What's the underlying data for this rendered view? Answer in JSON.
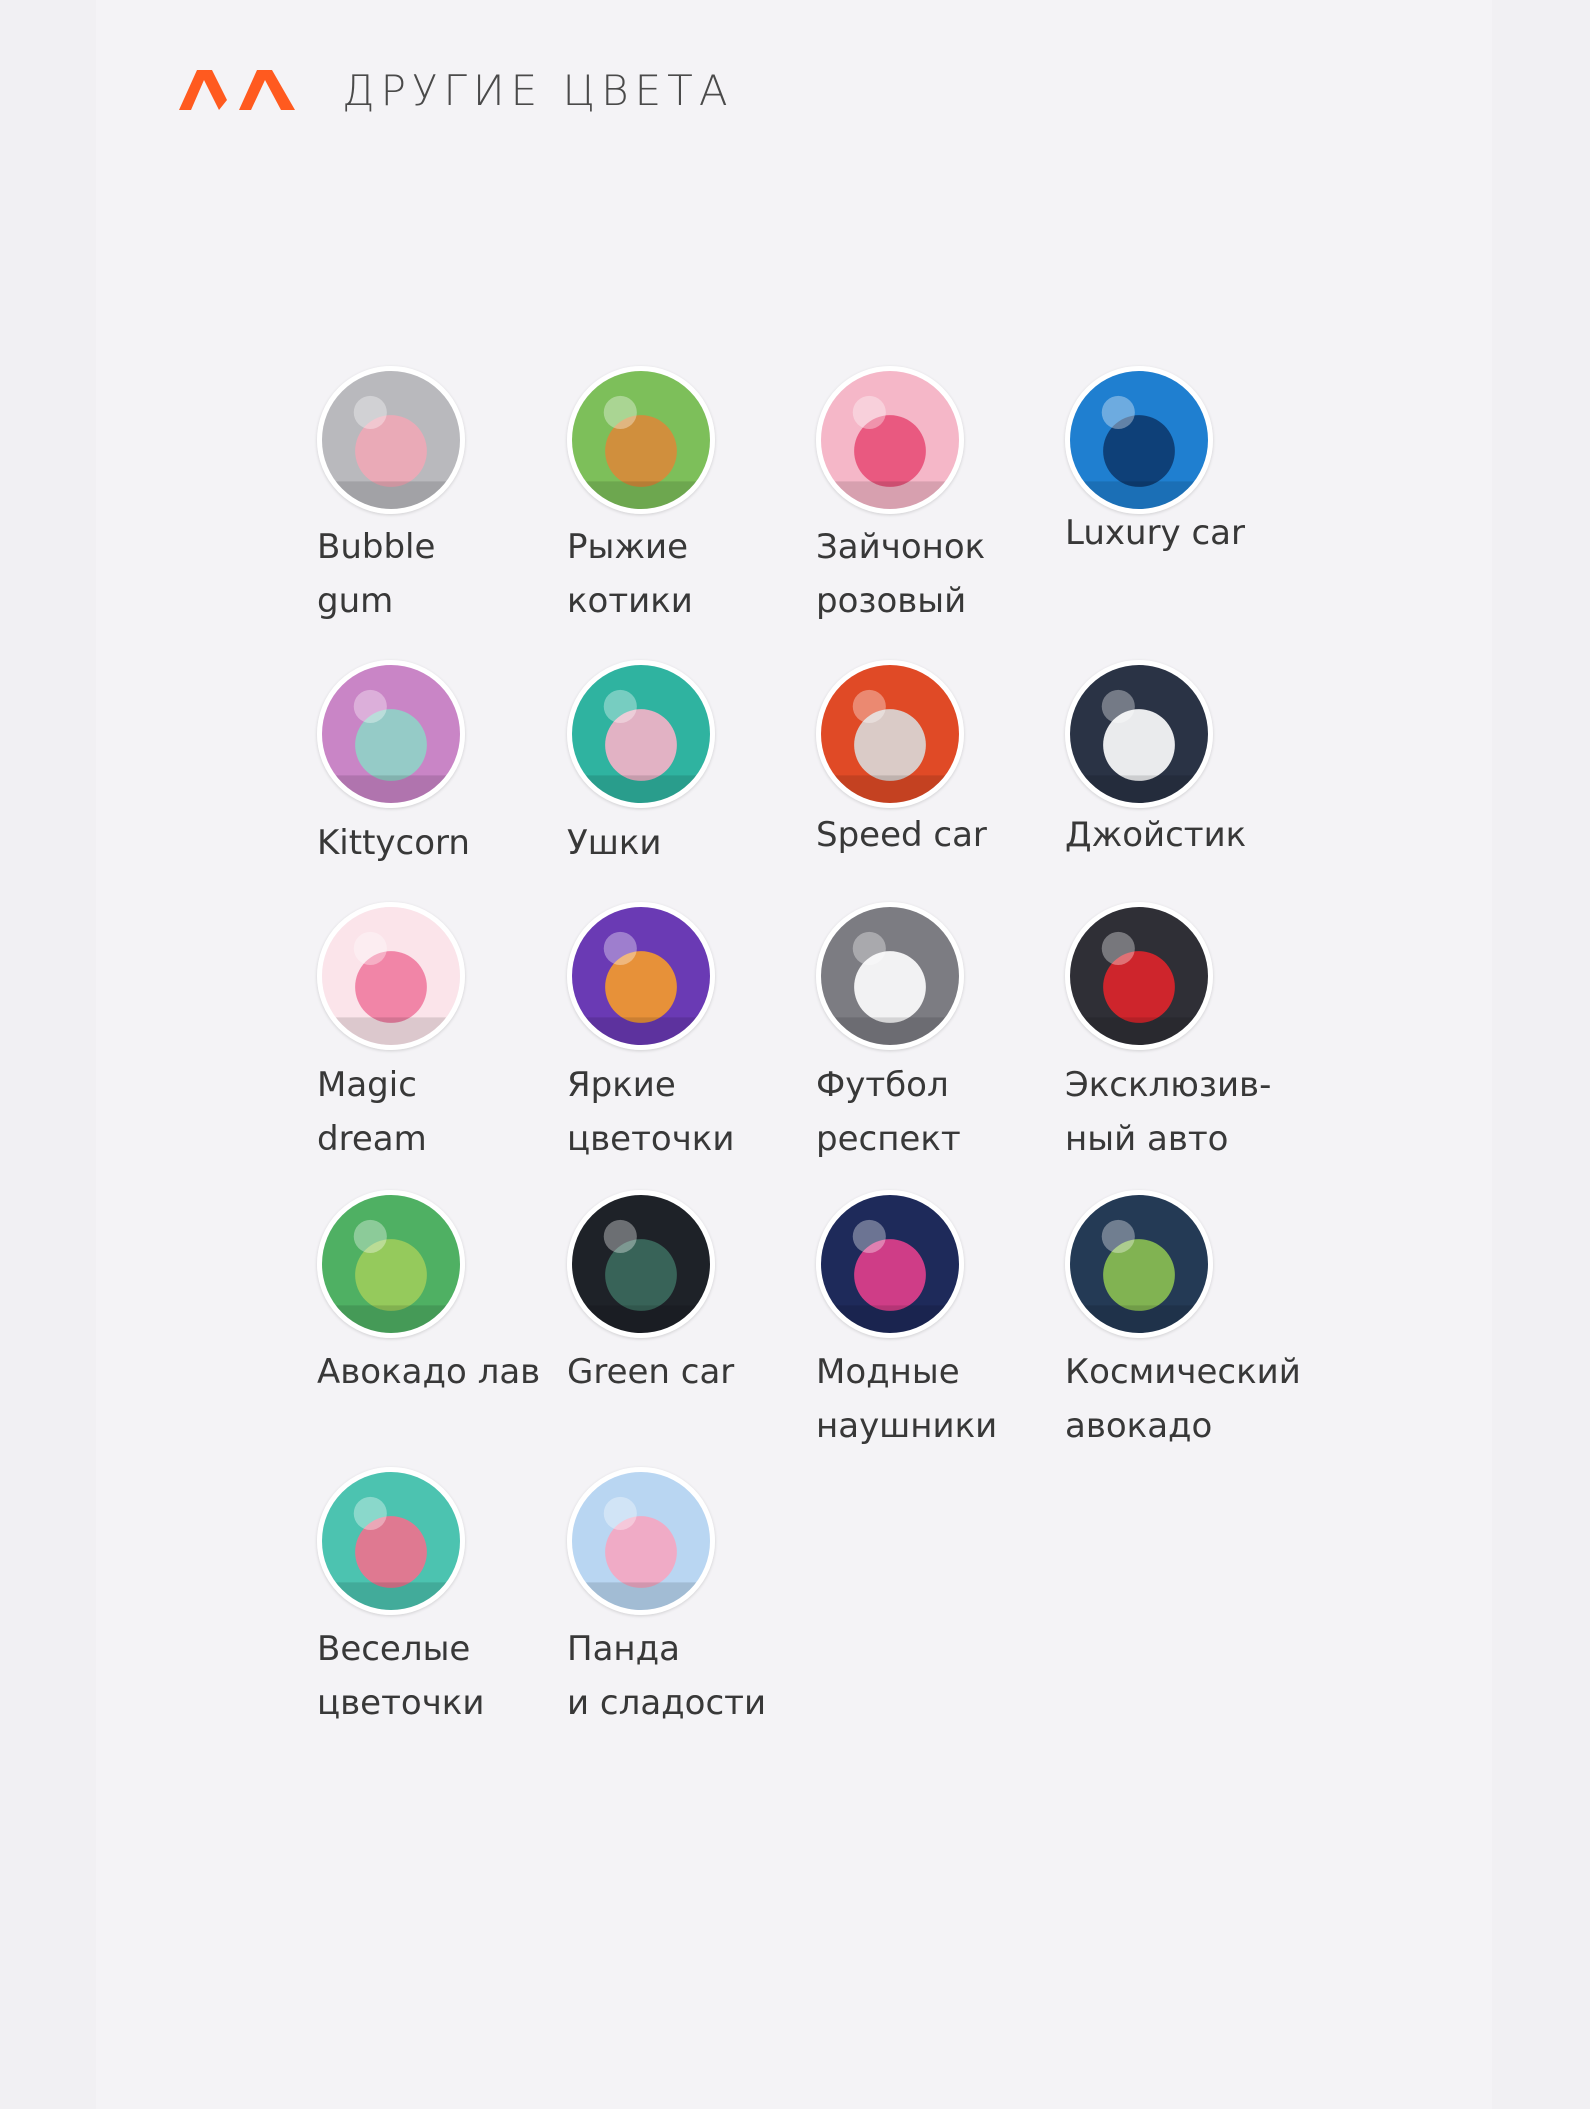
{
  "header": {
    "title": "ДРУГИЕ ЦВЕТА",
    "logo_icon": "brand-logo-icon",
    "brand_color": "#ff5a1f"
  },
  "swatches": [
    {
      "label": "Bubble\ngum",
      "icon": "bunny-bubblegum-icon",
      "bg": "#b9b9bd",
      "accent": "#f0a9b6"
    },
    {
      "label": "Рыжие\nкотики",
      "icon": "kittens-icon",
      "bg": "#7dbf5a",
      "accent": "#d98a3a"
    },
    {
      "label": "Зайчонок\nрозовый",
      "icon": "pink-bunny-icon",
      "bg": "#f5b7c8",
      "accent": "#e84f78"
    },
    {
      "label": "Luxury car",
      "icon": "blue-car-icon",
      "bg": "#1f7fd0",
      "accent": "#0c3a6e"
    },
    {
      "label": "Kittycorn",
      "icon": "kittycorn-icon",
      "bg": "#c985c6",
      "accent": "#8fd3c7"
    },
    {
      "label": "Ушки",
      "icon": "bunny-ears-icon",
      "bg": "#2fb3a0",
      "accent": "#f6b1c8"
    },
    {
      "label": "Speed car",
      "icon": "speed-car-icon",
      "bg": "#e04a26",
      "accent": "#d9d9d9"
    },
    {
      "label": "Джойстик",
      "icon": "gamepad-icon",
      "bg": "#2a3345",
      "accent": "#ffffff"
    },
    {
      "label": "Magic\ndream",
      "icon": "unicorn-icon",
      "bg": "#fbe4ea",
      "accent": "#f07aa0"
    },
    {
      "label": "Яркие\nцветочки",
      "icon": "bright-flowers-icon",
      "bg": "#6a3ab4",
      "accent": "#f59b2b"
    },
    {
      "label": "Футбол\nреспект",
      "icon": "soccer-ball-icon",
      "bg": "#7c7c82",
      "accent": "#ffffff"
    },
    {
      "label": "Эксклюзив-\nный авто",
      "icon": "red-car-icon",
      "bg": "#2f2f36",
      "accent": "#e0252b"
    },
    {
      "label": "Авокадо лав",
      "icon": "avocado-love-icon",
      "bg": "#4fb063",
      "accent": "#9ccd5b"
    },
    {
      "label": "Green car",
      "icon": "green-car-icon",
      "bg": "#1e2228",
      "accent": "#3b6a5d"
    },
    {
      "label": "Модные\nнаушники",
      "icon": "headphones-icon",
      "bg": "#1e2a5a",
      "accent": "#e23f8c"
    },
    {
      "label": "Космический\nавокадо",
      "icon": "space-avocado-icon",
      "bg": "#243a55",
      "accent": "#8cc152"
    },
    {
      "label": "Веселые\nцветочки",
      "icon": "plants-friends-icon",
      "bg": "#4cc3b0",
      "accent": "#f0718e"
    },
    {
      "label": "Панда\nи сладости",
      "icon": "panda-sweets-icon",
      "bg": "#b9d6f2",
      "accent": "#f6a6c1"
    }
  ]
}
